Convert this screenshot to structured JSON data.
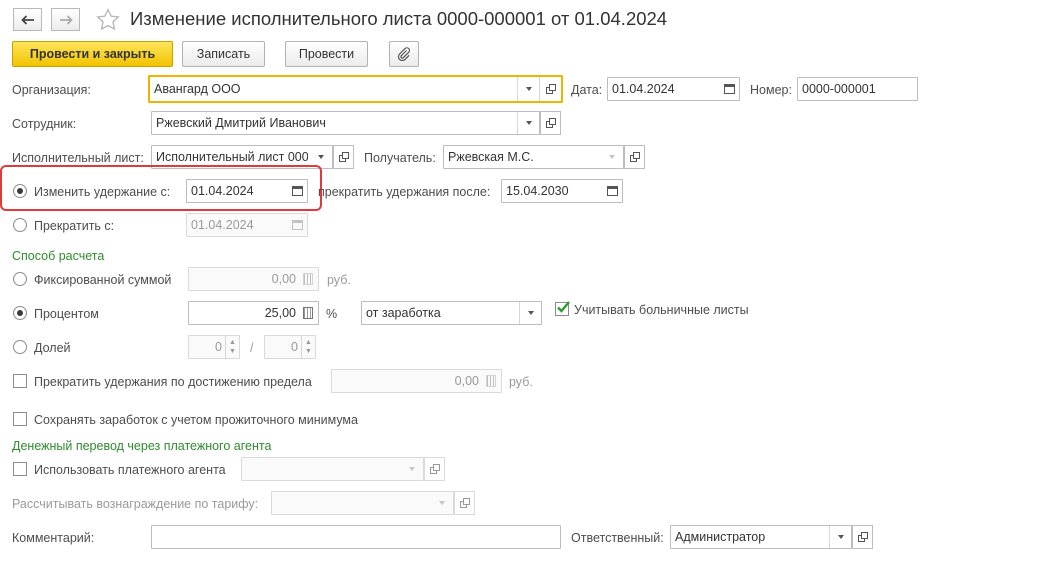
{
  "window": {
    "title": "Изменение исполнительного листа 0000-000001 от 01.04.2024"
  },
  "toolbar": {
    "post_close_label": "Провести и закрыть",
    "save_label": "Записать",
    "post_label": "Провести"
  },
  "header": {
    "organization_label": "Организация:",
    "organization_value": "Авангард ООО",
    "date_label": "Дата:",
    "date_value": "01.04.2024",
    "number_label": "Номер:",
    "number_value": "0000-000001",
    "employee_label": "Сотрудник:",
    "employee_value": "Ржевский Дмитрий Иванович",
    "writ_label": "Исполнительный лист:",
    "writ_value": "Исполнительный лист 000",
    "recipient_label": "Получатель:",
    "recipient_value": "Ржевская М.С."
  },
  "period": {
    "change_label": "Изменить удержание с:",
    "change_date": "01.04.2024",
    "stop_after_label": "прекратить удержания после:",
    "stop_after_date": "15.04.2030",
    "stop_from_label": "Прекратить с:",
    "stop_from_date": "01.04.2024"
  },
  "calculation": {
    "section_title": "Способ расчета",
    "fixed_label": "Фиксированной суммой",
    "fixed_value": "0,00",
    "fixed_unit": "руб.",
    "percent_label": "Процентом",
    "percent_value": "25,00",
    "percent_unit": "%",
    "percent_base": "от заработка",
    "sick_leave_label": "Учитывать больничные листы",
    "share_label": "Долей",
    "share_numerator": "0",
    "share_separator": "/",
    "share_denominator": "0",
    "limit_label": "Прекратить удержания по достижению предела",
    "limit_value": "0,00",
    "limit_unit": "руб.",
    "subsistence_label": "Сохранять заработок с учетом прожиточного минимума"
  },
  "transfer": {
    "section_title": "Денежный перевод через платежного агента",
    "use_agent_label": "Использовать платежного агента",
    "tariff_label": "Рассчитывать вознаграждение по тарифу:"
  },
  "footer": {
    "comment_label": "Комментарий:",
    "comment_value": "",
    "responsible_label": "Ответственный:",
    "responsible_value": "Администратор"
  },
  "state": {
    "selected_period": "change",
    "selected_method": "percent",
    "sick_leave_checked": true,
    "limit_checked": false,
    "subsistence_checked": false,
    "use_agent_checked": false
  },
  "colors": {
    "primary_button": "#f2c300",
    "section_title": "#2e8b2e",
    "highlight": "#e03b3b",
    "focus": "#f0b400"
  }
}
